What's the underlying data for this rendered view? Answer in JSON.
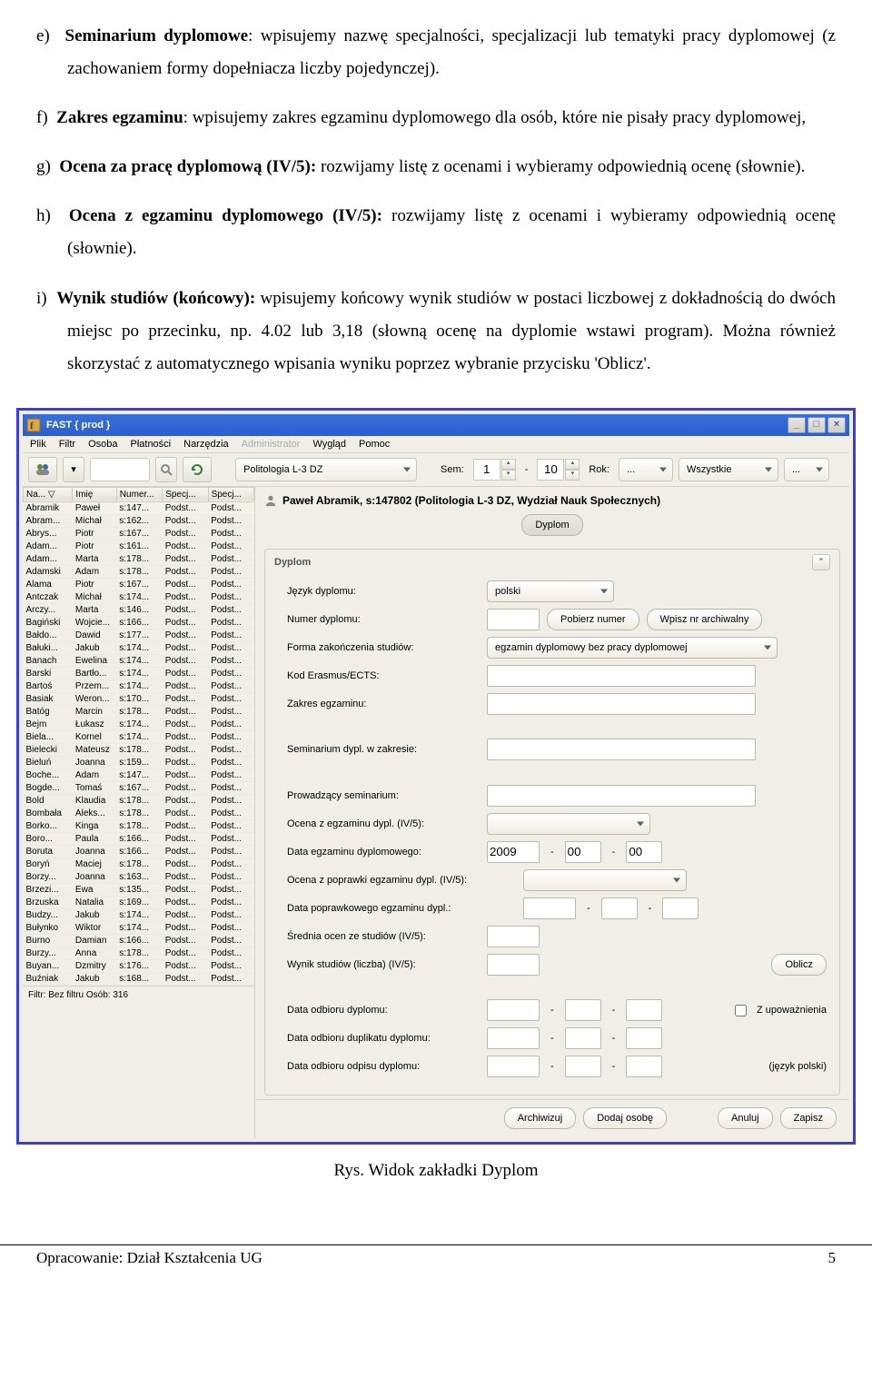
{
  "doc": {
    "items": {
      "e": {
        "marker": "e)",
        "title": "Seminarium dyplomowe",
        "rest": ": wpisujemy nazwę specjalności, specjalizacji lub tematyki pracy dyplomowej (z zachowaniem formy dopełniacza liczby pojedynczej)."
      },
      "f": {
        "marker": "f)",
        "title": "Zakres egzaminu",
        "rest": ": wpisujemy zakres egzaminu dyplomowego dla osób, które nie pisały pracy dyplomowej,"
      },
      "g": {
        "marker": "g)",
        "title": "Ocena za pracę dyplomową (IV/5):",
        "rest": " rozwijamy listę z ocenami i wybieramy odpowiednią ocenę (słownie)."
      },
      "h": {
        "marker": "h)",
        "title": "Ocena z egzaminu dyplomowego (IV/5):",
        "rest": " rozwijamy listę z ocenami i wybieramy odpowiednią ocenę (słownie)."
      },
      "i": {
        "marker": "i)",
        "title": "Wynik studiów (końcowy):",
        "rest": " wpisujemy końcowy wynik studiów w postaci liczbowej z dokładnością do dwóch miejsc po przecinku, np. 4.02 lub 3,18 (słowną ocenę na dyplomie wstawi program). Można również skorzystać z automatycznego wpisania wyniku poprzez wybranie przycisku 'Oblicz'."
      }
    },
    "caption": "Rys. Widok zakładki Dyplom",
    "footer_left": "Opracowanie: Dział Kształcenia UG",
    "footer_right": "5"
  },
  "app": {
    "title": "FAST { prod }",
    "menu": [
      "Plik",
      "Filtr",
      "Osoba",
      "Płatności",
      "Narzędzia",
      "Administrator",
      "Wygląd",
      "Pomoc"
    ],
    "toolbar": {
      "program": "Politologia L-3 DZ",
      "sem_label": "Sem:",
      "sem_from": "1",
      "sem_to": "10",
      "rok_label": "Rok:",
      "rok_val": "...",
      "wsz": "Wszystkie",
      "more": "..."
    },
    "left": {
      "cols": [
        "Na... ▽",
        "Imię",
        "Numer...",
        "Specj...",
        "Specj..."
      ],
      "rows": [
        [
          "Abramik",
          "Paweł",
          "s:147...",
          "Podst...",
          "Podst..."
        ],
        [
          "Abram...",
          "Michał",
          "s:162...",
          "Podst...",
          "Podst..."
        ],
        [
          "Abrys...",
          "Piotr",
          "s:167...",
          "Podst...",
          "Podst..."
        ],
        [
          "Adam...",
          "Piotr",
          "s:161...",
          "Podst...",
          "Podst..."
        ],
        [
          "Adam...",
          "Marta",
          "s:178...",
          "Podst...",
          "Podst..."
        ],
        [
          "Adamski",
          "Adam",
          "s:178...",
          "Podst...",
          "Podst..."
        ],
        [
          "Alama",
          "Piotr",
          "s:167...",
          "Podst...",
          "Podst..."
        ],
        [
          "Antczak",
          "Michał",
          "s:174...",
          "Podst...",
          "Podst..."
        ],
        [
          "Arczy...",
          "Marta",
          "s:146...",
          "Podst...",
          "Podst..."
        ],
        [
          "Bagiński",
          "Wojcie...",
          "s:166...",
          "Podst...",
          "Podst..."
        ],
        [
          "Bałdo...",
          "Dawid",
          "s:177...",
          "Podst...",
          "Podst..."
        ],
        [
          "Bałuki...",
          "Jakub",
          "s:174...",
          "Podst...",
          "Podst..."
        ],
        [
          "Banach",
          "Ewelina",
          "s:174...",
          "Podst...",
          "Podst..."
        ],
        [
          "Barski",
          "Bartło...",
          "s:174...",
          "Podst...",
          "Podst..."
        ],
        [
          "Bartoś",
          "Przem...",
          "s:174...",
          "Podst...",
          "Podst..."
        ],
        [
          "Basiak",
          "Weron...",
          "s:170...",
          "Podst...",
          "Podst..."
        ],
        [
          "Batóg",
          "Marcin",
          "s:178...",
          "Podst...",
          "Podst..."
        ],
        [
          "Bejm",
          "Łukasz",
          "s:174...",
          "Podst...",
          "Podst..."
        ],
        [
          "Biela...",
          "Kornel",
          "s:174...",
          "Podst...",
          "Podst..."
        ],
        [
          "Bielecki",
          "Mateusz",
          "s:178...",
          "Podst...",
          "Podst..."
        ],
        [
          "Bieluń",
          "Joanna",
          "s:159...",
          "Podst...",
          "Podst..."
        ],
        [
          "Boche...",
          "Adam",
          "s:147...",
          "Podst...",
          "Podst..."
        ],
        [
          "Bogde...",
          "Tomaś",
          "s:167...",
          "Podst...",
          "Podst..."
        ],
        [
          "Bold",
          "Klaudia",
          "s:178...",
          "Podst...",
          "Podst..."
        ],
        [
          "Bombała",
          "Aleks...",
          "s:178...",
          "Podst...",
          "Podst..."
        ],
        [
          "Borko...",
          "Kinga",
          "s:178...",
          "Podst...",
          "Podst..."
        ],
        [
          "Boro...",
          "Paula",
          "s:166...",
          "Podst...",
          "Podst..."
        ],
        [
          "Boruta",
          "Joanna",
          "s:166...",
          "Podst...",
          "Podst..."
        ],
        [
          "Boryń",
          "Maciej",
          "s:178...",
          "Podst...",
          "Podst..."
        ],
        [
          "Borzy...",
          "Joanna",
          "s:163...",
          "Podst...",
          "Podst..."
        ],
        [
          "Brzezi...",
          "Ewa",
          "s:135...",
          "Podst...",
          "Podst..."
        ],
        [
          "Brzuska",
          "Natalia",
          "s:169...",
          "Podst...",
          "Podst..."
        ],
        [
          "Budzy...",
          "Jakub",
          "s:174...",
          "Podst...",
          "Podst..."
        ],
        [
          "Bułynko",
          "Wiktor",
          "s:174...",
          "Podst...",
          "Podst..."
        ],
        [
          "Burno",
          "Damian",
          "s:166...",
          "Podst...",
          "Podst..."
        ],
        [
          "Burzy...",
          "Anna",
          "s:178...",
          "Podst...",
          "Podst..."
        ],
        [
          "Buyan...",
          "Dzmitry",
          "s:176...",
          "Podst...",
          "Podst..."
        ],
        [
          "Buźniak",
          "Jakub",
          "s:168...",
          "Podst...",
          "Podst..."
        ]
      ],
      "footer": "Filtr: Bez filtru  Osób: 316"
    },
    "right": {
      "person": "Paweł Abramik, s:147802 (Politologia L-3 DZ, Wydział Nauk Społecznych)",
      "tab": "Dyplom",
      "panel_title": "Dyplom",
      "labels": {
        "jezyk": "Język dyplomu:",
        "jezyk_val": "polski",
        "numer": "Numer dyplomu:",
        "btn_pobierz": "Pobierz numer",
        "btn_wpisz": "Wpisz nr archiwalny",
        "forma": "Forma zakończenia studiów:",
        "forma_val": "egzamin dyplomowy bez pracy dyplomowej",
        "kod": "Kod Erasmus/ECTS:",
        "zakres": "Zakres egzaminu:",
        "semin": "Seminarium dypl. w zakresie:",
        "prow": "Prowadzący seminarium:",
        "ocena_egz": "Ocena z egzaminu dypl. (IV/5):",
        "data_egz": "Data egzaminu dyplomowego:",
        "date_y": "2009",
        "date_m": "00",
        "date_d": "00",
        "dash1": "-",
        "dash2": "-",
        "ocena_pop": "Ocena z poprawki egzaminu dypl. (IV/5):",
        "data_pop": "Data poprawkowego egzaminu dypl.:",
        "srednia": "Średnia ocen ze studiów (IV/5):",
        "wynik": "Wynik studiów (liczba) (IV/5):",
        "btn_oblicz": "Oblicz",
        "data_odb": "Data odbioru dyplomu:",
        "z_upow": "Z upoważnienia",
        "data_dup": "Data odbioru duplikatu dyplomu:",
        "data_odp": "Data odbioru odpisu dyplomu:",
        "jezyk_pl": "(język polski)"
      },
      "buttons": {
        "archiwizuj": "Archiwizuj",
        "dodaj": "Dodaj osobę",
        "anuluj": "Anuluj",
        "zapisz": "Zapisz"
      }
    }
  }
}
